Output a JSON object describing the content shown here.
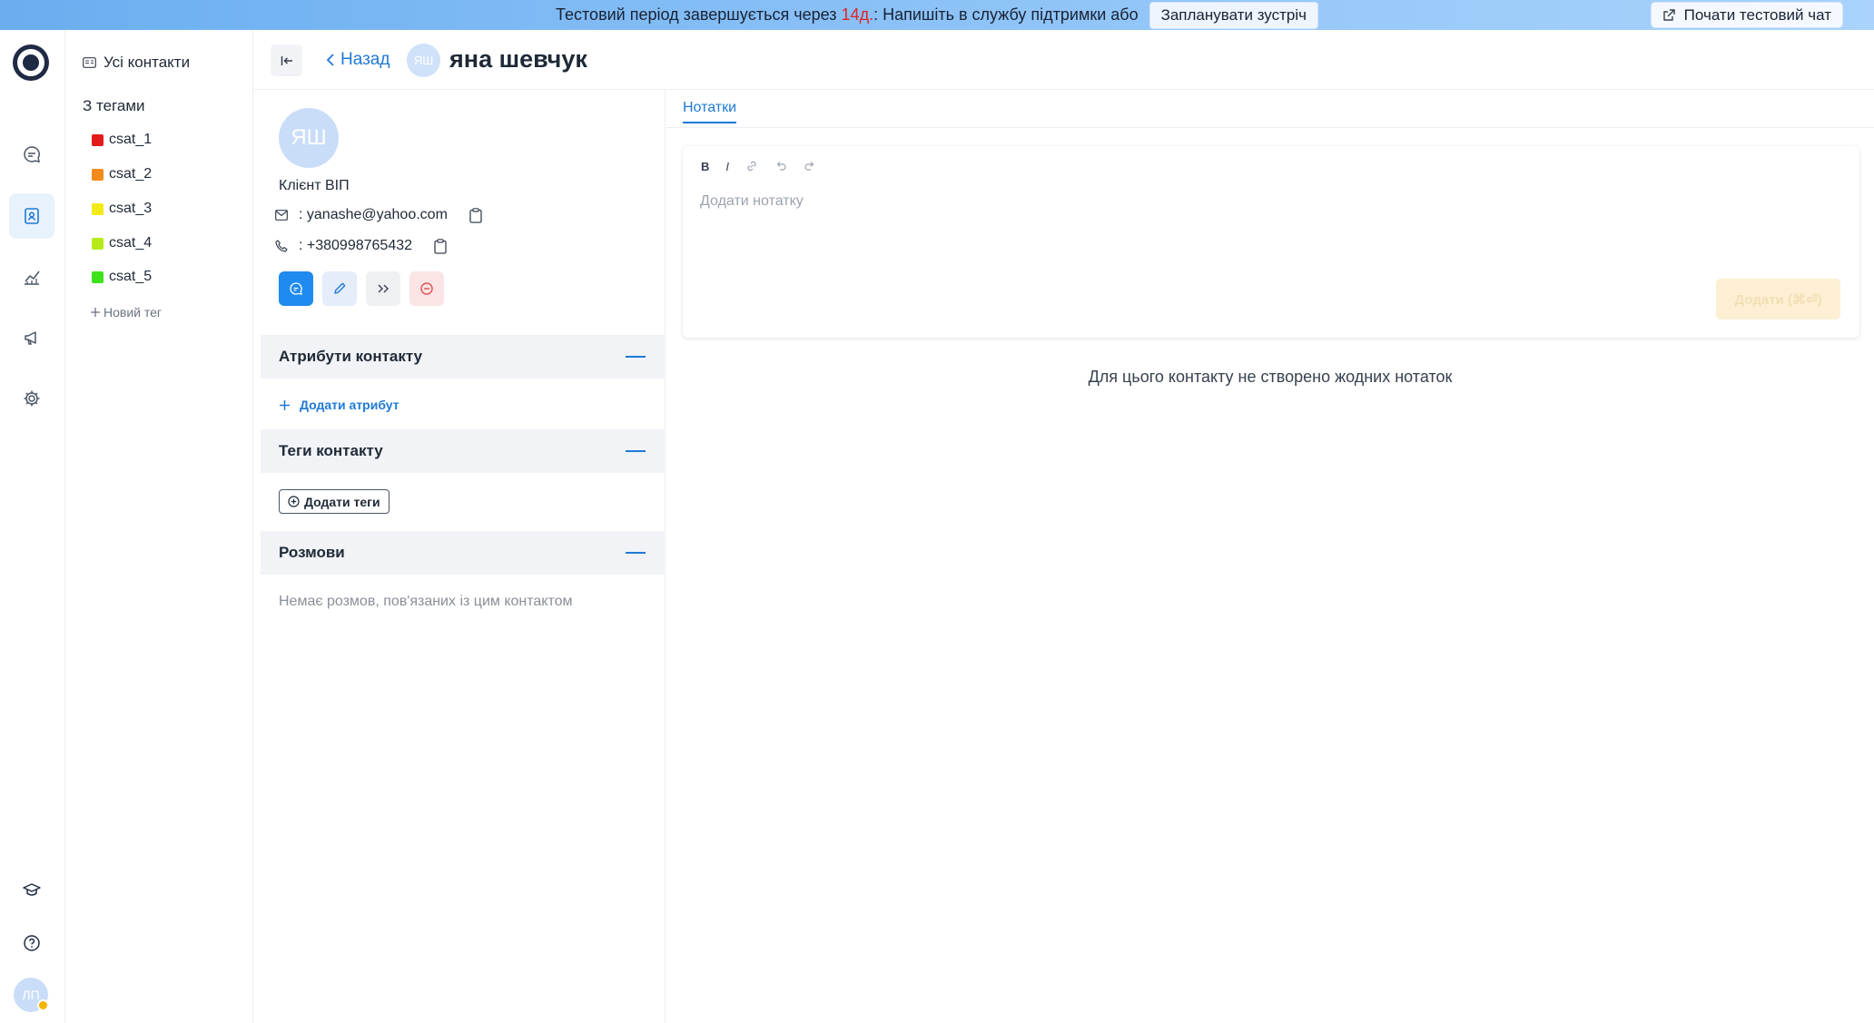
{
  "banner": {
    "text_before": "Тестовий період завершується через ",
    "days": "14д.",
    "text_after": ": Напишіть в службу підтримки або",
    "schedule_label": "Запланувати зустріч",
    "trial_chat_label": "Почати тестовий чат"
  },
  "rail": {
    "avatar_initials": "ЛП"
  },
  "contacts_sidebar": {
    "all_contacts_label": "Усі контакти",
    "tags_title": "З тегами",
    "tags": [
      {
        "label": "csat_1",
        "color": "#e41b1b"
      },
      {
        "label": "csat_2",
        "color": "#f28a1c"
      },
      {
        "label": "csat_3",
        "color": "#f2ea16"
      },
      {
        "label": "csat_4",
        "color": "#b7ea1a"
      },
      {
        "label": "csat_5",
        "color": "#3fe21b"
      }
    ],
    "new_tag_label": "Новий тег"
  },
  "header": {
    "back_label": "Назад",
    "avatar_initials": "ЯШ",
    "contact_name": "яна шевчук"
  },
  "contact": {
    "avatar_initials": "ЯШ",
    "subtitle": "Клієнт ВІП",
    "email": ": yanashe@yahoo.com",
    "phone": ": +380998765432",
    "sections": {
      "attributes": "Атрибути контакту",
      "add_attribute": "Додати атрибут",
      "tags": "Теги контакту",
      "add_tags": "Додати теги",
      "conversations": "Розмови",
      "no_conversations": "Немає розмов, пов'язаних із цим контактом"
    }
  },
  "notes": {
    "tab_label": "Нотатки",
    "placeholder": "Додати нотатку",
    "submit_label": "Додати (⌘⏎)",
    "empty_text": "Для цього контакту не створено жодних нотаток"
  },
  "colors": {
    "accent": "#1f7ad6",
    "banner_start": "#6aaef0",
    "days_red": "#e02424"
  }
}
